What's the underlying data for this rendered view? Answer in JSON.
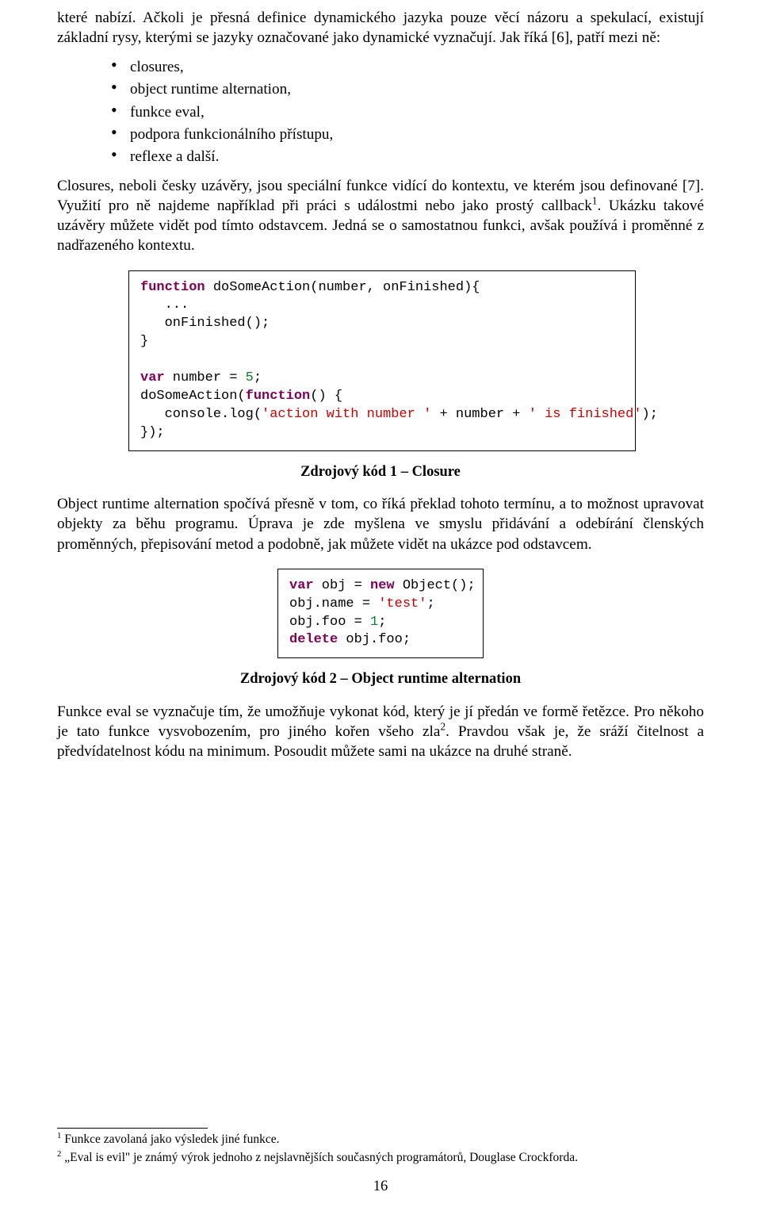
{
  "para1": "které nabízí. Ačkoli je přesná definice dynamického jazyka pouze věcí názoru a spekulací, existují základní rysy, kterými se jazyky označované jako dynamické vyznačují. Jak říká [6], patří mezi ně:",
  "bullets": {
    "0": "closures,",
    "1": "object runtime alternation,",
    "2": "funkce eval,",
    "3": "podpora funkcionálního přístupu,",
    "4": "reflexe a další."
  },
  "para2_pre": "Closures, neboli česky uzávěry, jsou speciální funkce vidící do kontextu, ve kterém jsou definované [7]. Využití pro ně najdeme například při práci s událostmi nebo jako prostý callback",
  "para2_sup": "1",
  "para2_post": ". Ukázku takové uzávěry můžete vidět pod tímto odstavcem. Jedná se o samostatnou funkci, avšak používá i proměnné z nadřazeného kontextu.",
  "code1": {
    "l1a": "function",
    "l1b": " doSomeAction(number, onFinished){",
    "l2": "   ...",
    "l3": "   onFinished();",
    "l4": "}",
    "l5": "",
    "l6a": "var",
    "l6b": " number = ",
    "l6c": "5",
    "l6d": ";",
    "l7a": "doSomeAction(",
    "l7b": "function",
    "l7c": "() {",
    "l8a": "   console.log(",
    "l8b": "'action with number '",
    "l8c": " + number + ",
    "l8d": "' is finished'",
    "l8e": ");",
    "l9": "});"
  },
  "caption1": "Zdrojový kód 1 – Closure",
  "para3": "Object runtime alternation spočívá přesně v tom, co říká překlad tohoto termínu, a to možnost upravovat objekty za běhu programu. Úprava je zde myšlena ve smyslu přidávání a odebírání členských proměnných, přepisování metod a podobně, jak můžete vidět na ukázce pod odstavcem.",
  "code2": {
    "l1a": "var",
    "l1b": " obj = ",
    "l1c": "new",
    "l1d": " Object();",
    "l2a": "obj.name = ",
    "l2b": "'test'",
    "l2c": ";",
    "l3a": "obj.foo = ",
    "l3b": "1",
    "l3c": ";",
    "l4a": "delete",
    "l4b": " obj.foo;"
  },
  "caption2": "Zdrojový kód 2 – Object runtime alternation",
  "para4_pre": "Funkce eval se vyznačuje tím, že umožňuje vykonat kód, který je jí předán ve formě řetězce. Pro někoho je tato funkce vysvobozením, pro jiného kořen všeho zla",
  "para4_sup": "2",
  "para4_post": ". Pravdou však je, že sráží čitelnost a předvídatelnost kódu na minimum. Posoudit můžete sami na ukázce na druhé straně.",
  "fn1_sup": "1",
  "fn1": " Funkce zavolaná jako výsledek jiné funkce.",
  "fn2_sup": "2",
  "fn2": " „Eval is evil\" je známý výrok jednoho z nejslavnějších současných programátorů, Douglase Crockforda.",
  "pagenum": "16"
}
